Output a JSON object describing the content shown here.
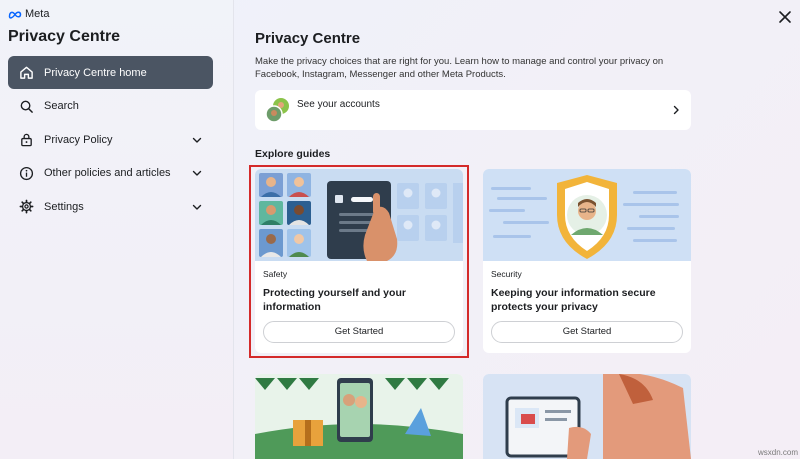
{
  "sidebar": {
    "brand": "Meta",
    "title": "Privacy Centre",
    "items": [
      {
        "label": "Privacy Centre home",
        "icon": "home-icon",
        "active": true,
        "expandable": false
      },
      {
        "label": "Search",
        "icon": "search-icon",
        "active": false,
        "expandable": false
      },
      {
        "label": "Privacy Policy",
        "icon": "lock-icon",
        "active": false,
        "expandable": true
      },
      {
        "label": "Other policies and articles",
        "icon": "info-icon",
        "active": false,
        "expandable": true
      },
      {
        "label": "Settings",
        "icon": "gear-icon",
        "active": false,
        "expandable": true
      }
    ]
  },
  "main": {
    "title": "Privacy Centre",
    "description": "Make the privacy choices that are right for you. Learn how to manage and control your privacy on Facebook, Instagram, Messenger and other Meta Products.",
    "accounts": {
      "label": "See your accounts"
    },
    "guides_label": "Explore guides",
    "guides": [
      {
        "category": "Safety",
        "title": "Protecting yourself and your information",
        "button": "Get Started",
        "highlighted": true
      },
      {
        "category": "Security",
        "title": "Keeping your information secure protects your privacy",
        "button": "Get Started",
        "highlighted": false
      },
      {
        "category": "",
        "title": "",
        "button": ""
      },
      {
        "category": "",
        "title": "",
        "button": ""
      }
    ]
  },
  "colors": {
    "active_nav": "#4b5563",
    "highlight": "#d42a2a",
    "meta_blue": "#0866ff"
  },
  "watermark": "wsxdn.com"
}
